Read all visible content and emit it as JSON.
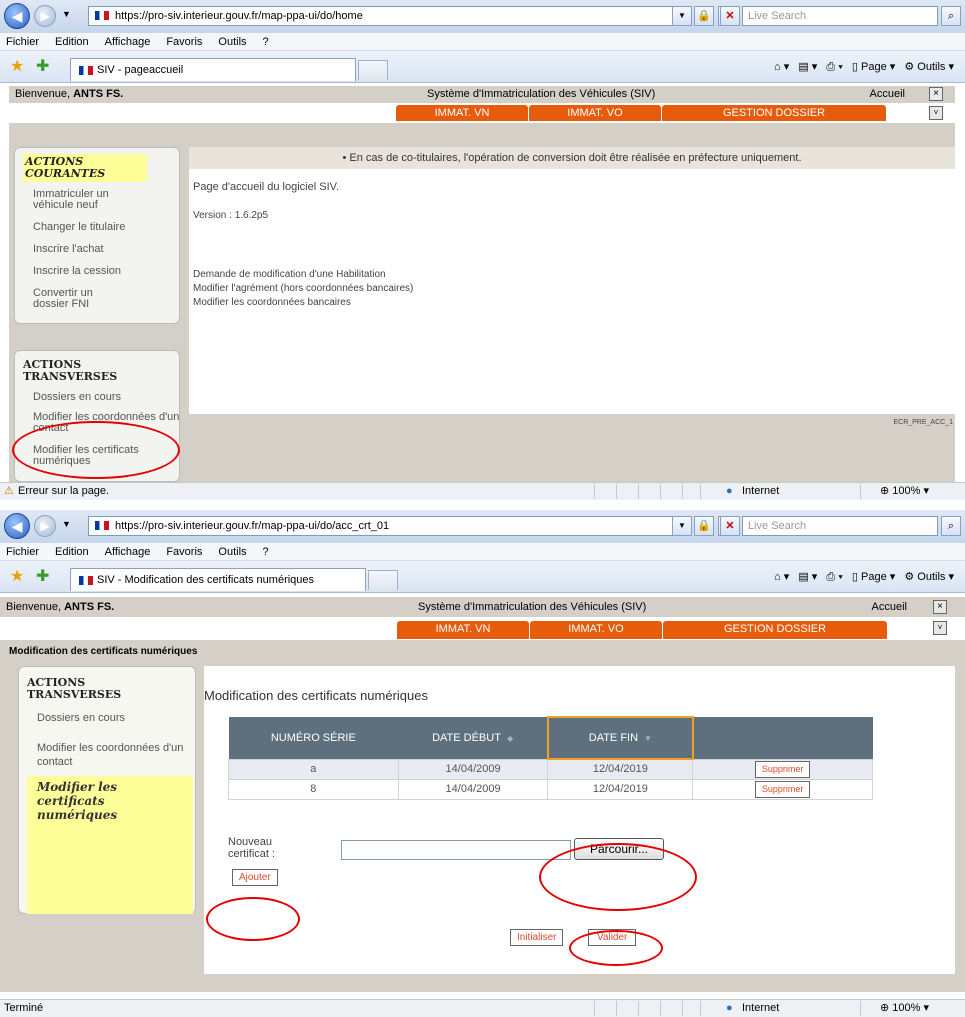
{
  "s1": {
    "browser": {
      "url": "https://pro-siv.interieur.gouv.fr/map-ppa-ui/do/home",
      "search_placeholder": "Live Search",
      "menu": [
        "Fichier",
        "Edition",
        "Affichage",
        "Favoris",
        "Outils",
        "?"
      ],
      "tab_title": "SIV - pageaccueil",
      "tools_page": "Page",
      "tools_outils": "Outils"
    },
    "header": {
      "welcome_prefix": "Bienvenue, ",
      "welcome_user": "ANTS FS.",
      "app_title": "Système d'Immatriculation des Véhicules (SIV)",
      "home_link": "Accueil"
    },
    "nav": [
      "IMMAT. VN",
      "IMMAT. VO",
      "GESTION DOSSIER"
    ],
    "sidebar": {
      "courantes_title": "ACTIONS COURANTES",
      "courantes_items": [
        "Immatriculer un véhicule neuf",
        "Changer le titulaire",
        "Inscrire l'achat",
        "Inscrire la cession",
        "Convertir un dossier FNI"
      ],
      "transverses_title": "ACTIONS TRANSVERSES",
      "transverses_items": [
        "Dossiers en cours",
        "Modifier les coordonnées d'un contact",
        "Modifier les certificats numériques"
      ]
    },
    "main": {
      "notice": "En cas de co-titulaires, l'opération de conversion doit être réalisée en préfecture uniquement.",
      "welcome": "Page d'accueil du logiciel SIV.",
      "version": "Version : 1.6.2p5",
      "links": [
        "Demande de modification d'une Habilitation",
        "Modifier l'agrément (hors coordonnées bancaires)",
        "Modifier les coordonnées bancaires"
      ],
      "screen_code": "ECR_PRE_ACC_1"
    },
    "status": {
      "text": "Erreur sur la page.",
      "zone": "Internet",
      "zoom": "100%"
    }
  },
  "s2": {
    "browser": {
      "url": "https://pro-siv.interieur.gouv.fr/map-ppa-ui/do/acc_crt_01",
      "search_placeholder": "Live Search",
      "menu": [
        "Fichier",
        "Edition",
        "Affichage",
        "Favoris",
        "Outils",
        "?"
      ],
      "tab_title": "SIV - Modification des certificats numériques",
      "tools_page": "Page",
      "tools_outils": "Outils"
    },
    "header": {
      "welcome_prefix": "Bienvenue, ",
      "welcome_user": "ANTS FS.",
      "app_title": "Système d'Immatriculation des Véhicules (SIV)",
      "home_link": "Accueil"
    },
    "nav": [
      "IMMAT. VN",
      "IMMAT. VO",
      "GESTION DOSSIER"
    ],
    "page_header": "Modification des certificats numériques",
    "sidebar": {
      "transverses_title": "ACTIONS TRANSVERSES",
      "transverses_items": [
        "Dossiers en cours",
        "Modifier les coordonnées d'un contact",
        "Modifier les certificats numériques"
      ]
    },
    "main": {
      "title": "Modification des certificats numériques",
      "columns": [
        "NUMÉRO SÉRIE",
        "DATE DÉBUT",
        "DATE FIN"
      ],
      "rows": [
        {
          "serial": "a",
          "start": "14/04/2009",
          "end": "12/04/2019",
          "action": "Supprimer"
        },
        {
          "serial": "8",
          "start": "14/04/2009",
          "end": "12/04/2019",
          "action": "Supprimer"
        }
      ],
      "new_cert_label": "Nouveau certificat :",
      "browse_button": "Parcourir...",
      "add_button": "Ajouter",
      "reset_button": "Initialiser",
      "submit_button": "Valider"
    },
    "status": {
      "text": "Terminé",
      "zone": "Internet",
      "zoom": "100%"
    }
  }
}
